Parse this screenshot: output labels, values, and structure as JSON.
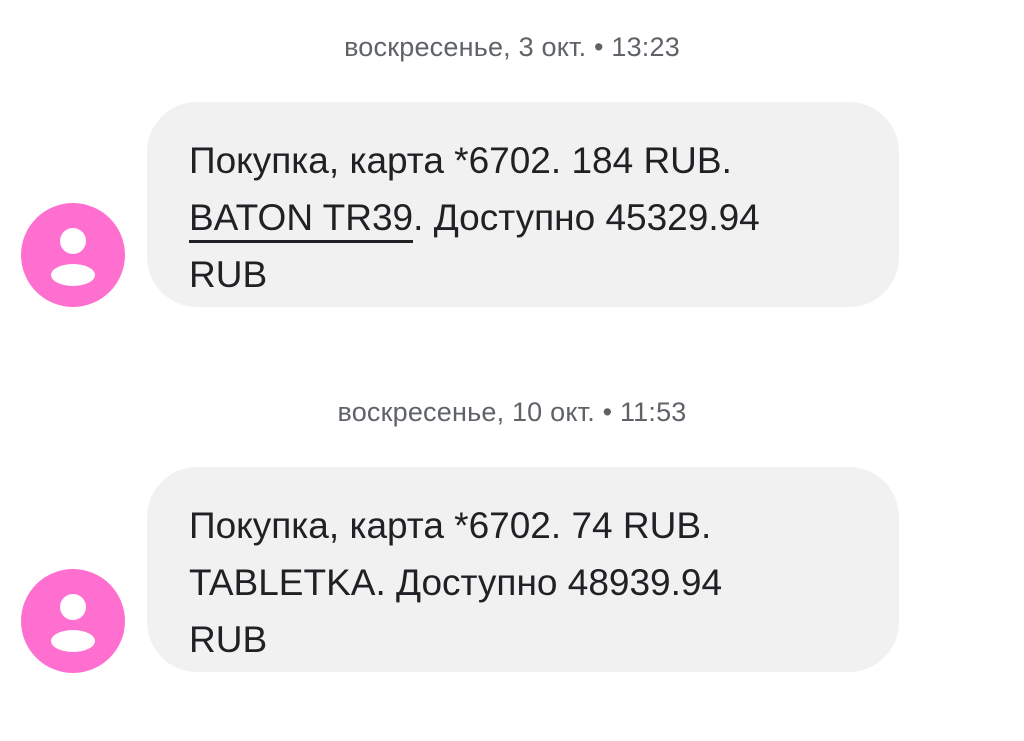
{
  "messages": [
    {
      "timestamp": "воскресенье, 3 окт. • 13:23",
      "line1": "Покупка, карта *6702. 184 RUB.",
      "merchant": "BATON TR39",
      "line2_rest": ". Доступно 45329.94",
      "line3": "RUB",
      "avatar_icon": "person-icon",
      "avatar_color": "#ff6fd0"
    },
    {
      "timestamp": "воскресенье, 10 окт. • 11:53",
      "line1": "Покупка, карта *6702. 74 RUB.",
      "merchant": "TABLETKA",
      "line2_rest": ". Доступно 48939.94",
      "line3": "RUB",
      "avatar_icon": "person-icon",
      "avatar_color": "#ff6fd0"
    }
  ],
  "colors": {
    "bubble": "#f1f1f1",
    "timestamp": "#5f6368",
    "text": "#202124"
  }
}
